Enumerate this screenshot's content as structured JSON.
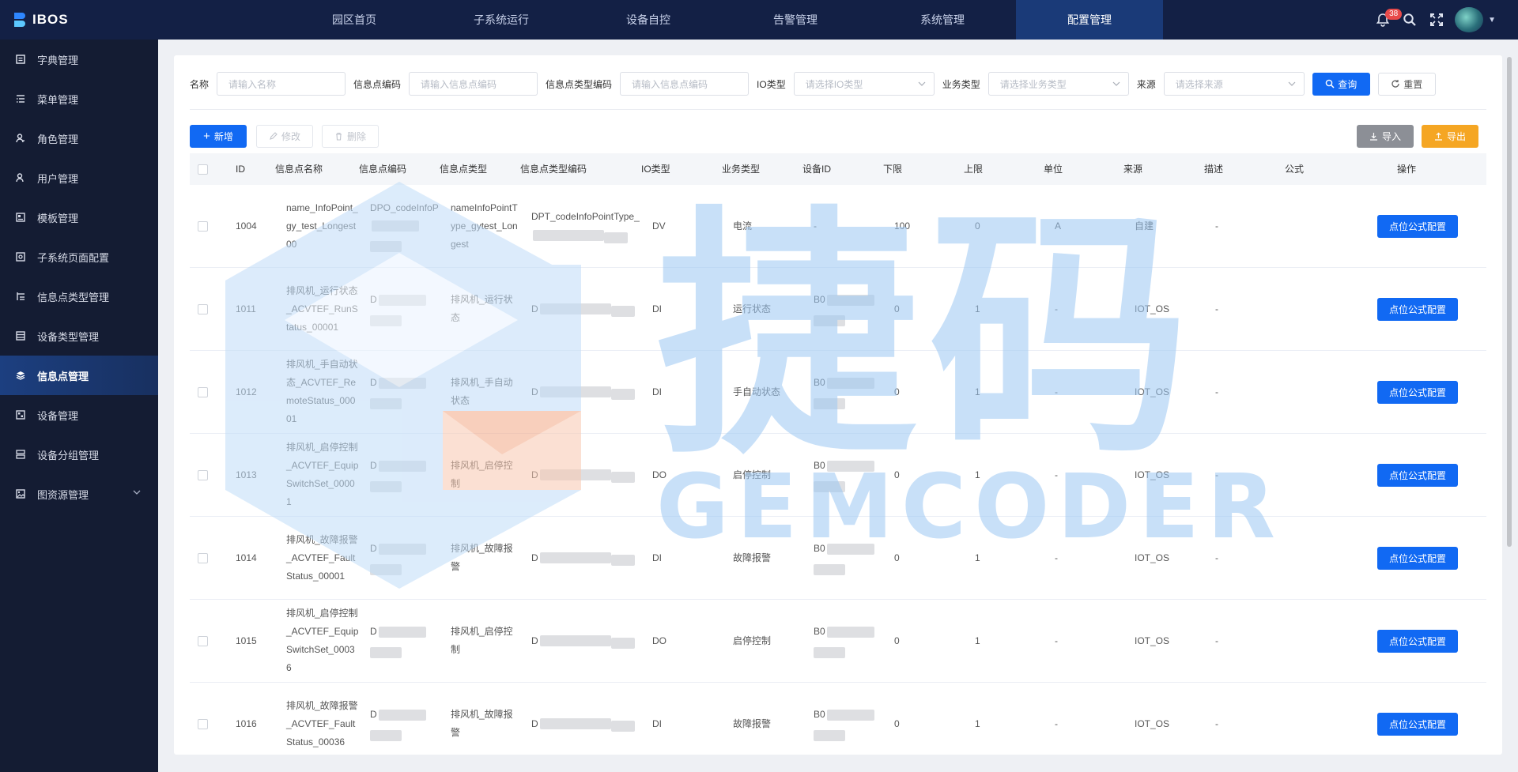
{
  "app": {
    "name": "IBOS"
  },
  "nav": [
    {
      "label": "园区首页"
    },
    {
      "label": "子系统运行"
    },
    {
      "label": "设备自控"
    },
    {
      "label": "告警管理"
    },
    {
      "label": "系统管理"
    },
    {
      "label": "配置管理"
    }
  ],
  "header": {
    "notification_count": "38"
  },
  "sidebar": [
    {
      "label": "字典管理",
      "icon": "book-icon"
    },
    {
      "label": "菜单管理",
      "icon": "list-icon"
    },
    {
      "label": "角色管理",
      "icon": "user-role-icon"
    },
    {
      "label": "用户管理",
      "icon": "user-icon"
    },
    {
      "label": "模板管理",
      "icon": "template-icon"
    },
    {
      "label": "子系统页面配置",
      "icon": "page-config-icon"
    },
    {
      "label": "信息点类型管理",
      "icon": "type-list-icon"
    },
    {
      "label": "设备类型管理",
      "icon": "device-type-icon"
    },
    {
      "label": "信息点管理",
      "icon": "layers-icon"
    },
    {
      "label": "设备管理",
      "icon": "device-icon"
    },
    {
      "label": "设备分组管理",
      "icon": "group-icon"
    },
    {
      "label": "图资源管理",
      "icon": "image-icon"
    }
  ],
  "filters": {
    "name_label": "名称",
    "name_placeholder": "请输入名称",
    "code_label": "信息点编码",
    "code_placeholder": "请输入信息点编码",
    "type_code_label": "信息点类型编码",
    "type_code_placeholder": "请输入信息点编码",
    "io_label": "IO类型",
    "io_placeholder": "请选择IO类型",
    "biz_label": "业务类型",
    "biz_placeholder": "请选择业务类型",
    "source_label": "来源",
    "source_placeholder": "请选择来源",
    "query": "查询",
    "reset": "重置"
  },
  "toolbar": {
    "add": "新增",
    "edit": "修改",
    "delete": "删除",
    "import": "导入",
    "export": "导出"
  },
  "table": {
    "headers": [
      "ID",
      "信息点名称",
      "信息点编码",
      "信息点类型",
      "信息点类型编码",
      "IO类型",
      "业务类型",
      "设备ID",
      "下限",
      "上限",
      "单位",
      "来源",
      "描述",
      "公式",
      "操作"
    ],
    "op_label": "点位公式配置",
    "rows": [
      {
        "id": "1004",
        "name": "name_InfoPoint_gy_test_Longest00",
        "code": "DPO_codeInfoP",
        "type": "nameInfoPointType_gytest_Longest",
        "type_code": "DPT_codeInfoPointType_",
        "io": "DV",
        "biz": "电流",
        "device": "-",
        "low": "100",
        "high": "0",
        "unit": "A",
        "source": "自建",
        "desc": "-"
      },
      {
        "id": "1011",
        "name": "排风机_运行状态_ACVTEF_RunStatus_00001",
        "code": "D",
        "type": "排风机_运行状态",
        "type_code": "D",
        "io": "DI",
        "biz": "运行状态",
        "device": "B0",
        "low": "0",
        "high": "1",
        "unit": "-",
        "source": "IOT_OS",
        "desc": "-"
      },
      {
        "id": "1012",
        "name": "排风机_手自动状态_ACVTEF_RemoteStatus_00001",
        "code": "D",
        "type": "排风机_手自动状态",
        "type_code": "D",
        "io": "DI",
        "biz": "手自动状态",
        "device": "B0",
        "low": "0",
        "high": "1",
        "unit": "-",
        "source": "IOT_OS",
        "desc": "-"
      },
      {
        "id": "1013",
        "name": "排风机_启停控制_ACVTEF_EquipSwitchSet_00001",
        "code": "D",
        "type": "排风机_启停控制",
        "type_code": "D",
        "io": "DO",
        "biz": "启停控制",
        "device": "B0",
        "low": "0",
        "high": "1",
        "unit": "-",
        "source": "IOT_OS",
        "desc": "-"
      },
      {
        "id": "1014",
        "name": "排风机_故障报警_ACVTEF_FaultStatus_00001",
        "code": "D",
        "type": "排风机_故障报警",
        "type_code": "D",
        "io": "DI",
        "biz": "故障报警",
        "device": "B0",
        "low": "0",
        "high": "1",
        "unit": "-",
        "source": "IOT_OS",
        "desc": "-"
      },
      {
        "id": "1015",
        "name": "排风机_启停控制_ACVTEF_EquipSwitchSet_00036",
        "code": "D",
        "type": "排风机_启停控制",
        "type_code": "D",
        "io": "DO",
        "biz": "启停控制",
        "device": "B0",
        "low": "0",
        "high": "1",
        "unit": "-",
        "source": "IOT_OS",
        "desc": "-"
      },
      {
        "id": "1016",
        "name": "排风机_故障报警_ACVTEF_FaultStatus_00036",
        "code": "D",
        "type": "排风机_故障报警",
        "type_code": "D",
        "io": "DI",
        "biz": "故障报警",
        "device": "B0",
        "low": "0",
        "high": "1",
        "unit": "-",
        "source": "IOT_OS",
        "desc": "-"
      }
    ]
  },
  "watermark": {
    "cn": "捷码",
    "en": "GEMCODER"
  },
  "colors": {
    "topbar": "#132045",
    "sidebar": "#141c33",
    "primary": "#1169f3",
    "export": "#f5a623",
    "import": "#8c8f96"
  }
}
